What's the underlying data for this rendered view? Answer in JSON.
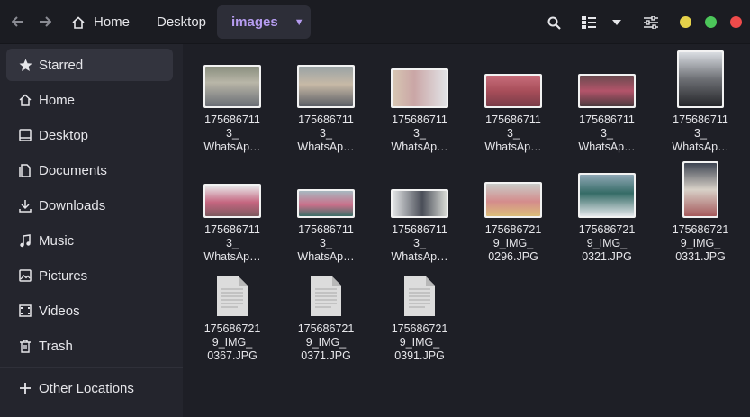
{
  "header": {
    "breadcrumbs": [
      "Home",
      "Desktop",
      "images"
    ],
    "colors": {
      "accent": "#b69cf0",
      "minimize": "#e5d14a",
      "maximize": "#4cc65a",
      "close": "#ef4b4b"
    }
  },
  "sidebar": {
    "items": [
      {
        "label": "Starred",
        "icon": "star-icon"
      },
      {
        "label": "Home",
        "icon": "home-icon"
      },
      {
        "label": "Desktop",
        "icon": "desktop-icon"
      },
      {
        "label": "Documents",
        "icon": "documents-icon"
      },
      {
        "label": "Downloads",
        "icon": "download-icon"
      },
      {
        "label": "Music",
        "icon": "music-icon"
      },
      {
        "label": "Pictures",
        "icon": "pictures-icon"
      },
      {
        "label": "Videos",
        "icon": "videos-icon"
      },
      {
        "label": "Trash",
        "icon": "trash-icon"
      }
    ],
    "other_locations": "Other Locations"
  },
  "files": [
    {
      "name": "175686711\n3_\nWhatsAp…",
      "kind": "photo"
    },
    {
      "name": "175686711\n3_\nWhatsAp…",
      "kind": "photo"
    },
    {
      "name": "175686711\n3_\nWhatsAp…",
      "kind": "photo"
    },
    {
      "name": "175686711\n3_\nWhatsAp…",
      "kind": "photo"
    },
    {
      "name": "175686711\n3_\nWhatsAp…",
      "kind": "photo"
    },
    {
      "name": "175686711\n3_\nWhatsAp…",
      "kind": "photo"
    },
    {
      "name": "175686711\n3_\nWhatsAp…",
      "kind": "photo"
    },
    {
      "name": "175686711\n3_\nWhatsAp…",
      "kind": "photo"
    },
    {
      "name": "175686711\n3_\nWhatsAp…",
      "kind": "photo"
    },
    {
      "name": "175686721\n9_IMG_\n0296.JPG",
      "kind": "photo"
    },
    {
      "name": "175686721\n9_IMG_\n0321.JPG",
      "kind": "photo"
    },
    {
      "name": "175686721\n9_IMG_\n0331.JPG",
      "kind": "photo"
    },
    {
      "name": "175686721\n9_IMG_\n0367.JPG",
      "kind": "document"
    },
    {
      "name": "175686721\n9_IMG_\n0371.JPG",
      "kind": "document"
    },
    {
      "name": "175686721\n9_IMG_\n0391.JPG",
      "kind": "document"
    }
  ]
}
